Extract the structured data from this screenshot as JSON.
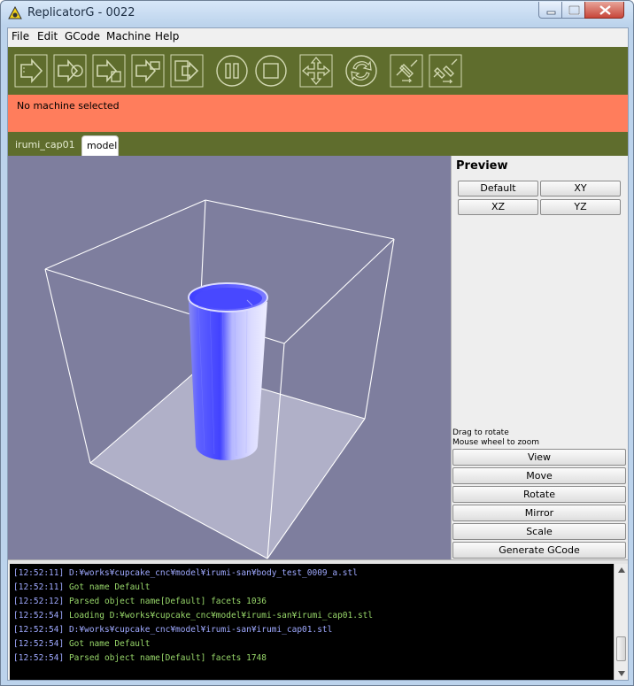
{
  "window": {
    "title": "ReplicatorG - 0022"
  },
  "menu": {
    "items": [
      "File",
      "Edit",
      "GCode",
      "Machine",
      "Help"
    ]
  },
  "toolbar": {
    "buttons": [
      {
        "name": "build-icon"
      },
      {
        "name": "simulate-icon"
      },
      {
        "name": "build-to-file-icon"
      },
      {
        "name": "upload-icon"
      },
      {
        "name": "build-remote-icon"
      },
      {
        "name": "pause-icon"
      },
      {
        "name": "stop-icon"
      },
      {
        "name": "control-panel-icon"
      },
      {
        "name": "reset-icon"
      },
      {
        "name": "connect-icon"
      },
      {
        "name": "disconnect-icon"
      }
    ],
    "background": "#5f6d2d"
  },
  "status": {
    "text": "No machine selected",
    "color": "#ff7d5c"
  },
  "tabs": [
    {
      "label": "irumi_cap01",
      "selected": false
    },
    {
      "label": "model",
      "selected": true
    }
  ],
  "preview": {
    "title": "Preview",
    "view_buttons": [
      "Default",
      "XY",
      "XZ",
      "YZ"
    ],
    "hint_line1": "Drag to rotate",
    "hint_line2": "Mouse wheel to zoom",
    "actions": [
      "View",
      "Move",
      "Rotate",
      "Mirror",
      "Scale",
      "Generate GCode"
    ]
  },
  "console": {
    "lines": [
      {
        "time": "[12:52:11]",
        "text": "D:¥works¥cupcake_cnc¥model¥irumi-san¥body_test_0009_a.stl",
        "kind": "path"
      },
      {
        "time": "[12:52:11]",
        "text": "Got name Default",
        "kind": "ok"
      },
      {
        "time": "[12:52:12]",
        "text": "Parsed object name[Default] facets 1036",
        "kind": "ok"
      },
      {
        "time": "[12:52:54]",
        "text": "Loading D:¥works¥cupcake_cnc¥model¥irumi-san¥irumi_cap01.stl",
        "kind": "ok"
      },
      {
        "time": "[12:52:54]",
        "text": "D:¥works¥cupcake_cnc¥model¥irumi-san¥irumi_cap01.stl",
        "kind": "path"
      },
      {
        "time": "[12:52:54]",
        "text": "Got name Default",
        "kind": "ok"
      },
      {
        "time": "[12:52:54]",
        "text": "Parsed object name[Default] facets 1748",
        "kind": "ok"
      }
    ]
  }
}
